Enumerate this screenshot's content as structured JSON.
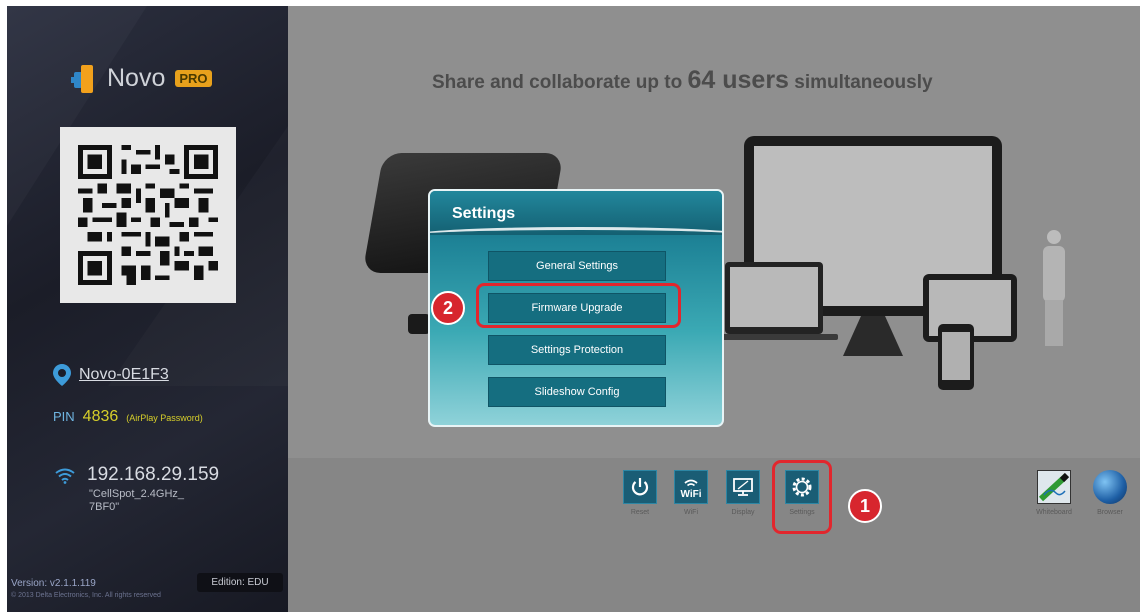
{
  "branding": {
    "name": "Novo",
    "badge": "PRO"
  },
  "device": {
    "name": "Novo-0E1F3",
    "pin_label": "PIN",
    "pin": "4836",
    "pin_note": "(AirPlay Password)",
    "ip": "192.168.29.159",
    "ssid": "\"CellSpot_2.4GHz_ 7BF0\""
  },
  "footer": {
    "version": "Version:  v2.1.1.119",
    "copyright": "© 2013 Delta Electronics, Inc. All rights reserved",
    "edition": "Edition: EDU"
  },
  "tagline": {
    "prefix": "Share and collaborate up to ",
    "emphasis": "64 users",
    "suffix": " simultaneously"
  },
  "dialog": {
    "title": "Settings",
    "items": [
      {
        "label": "General Settings"
      },
      {
        "label": "Firmware Upgrade"
      },
      {
        "label": "Settings Protection"
      },
      {
        "label": "Slideshow Config"
      }
    ]
  },
  "dock": {
    "reset": "Reset",
    "wifi": "WiFi",
    "display": "Display",
    "settings": "Settings",
    "whiteboard": "Whiteboard",
    "browser": "Browser"
  },
  "callouts": {
    "step1": "1",
    "step2": "2"
  },
  "colors": {
    "highlight": "#e2262d",
    "dialog_button": "#156e80",
    "pin_accent": "#d7cf2a"
  }
}
